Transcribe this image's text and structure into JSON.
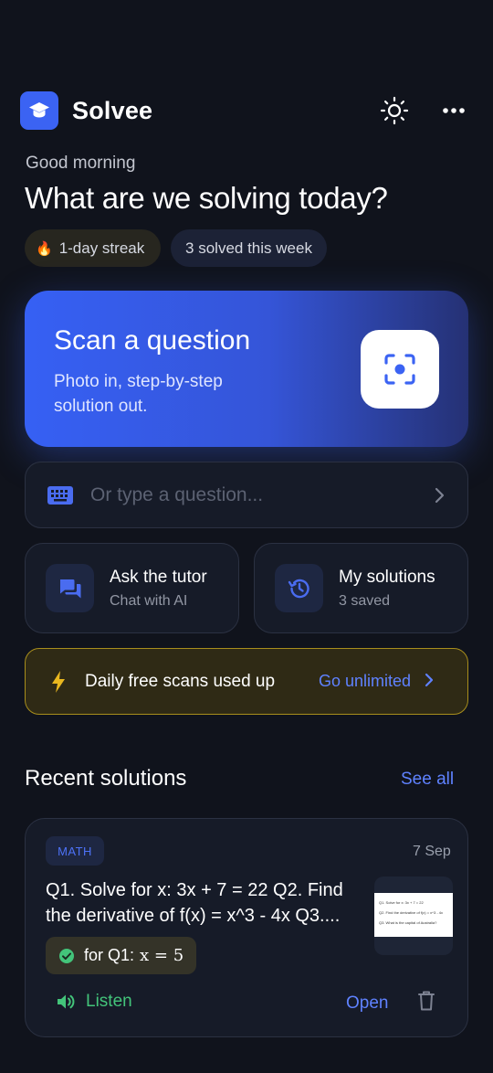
{
  "header": {
    "app_name": "Solvee",
    "logo_icon": "graduation-cap-icon",
    "theme_icon": "sun-icon",
    "menu_icon": "more-horizontal-icon"
  },
  "greeting": "Good morning",
  "headline": "What are we solving today?",
  "chips": {
    "streak_icon": "🔥",
    "streak": "1-day streak",
    "week": "3 solved this week"
  },
  "scan_card": {
    "title": "Scan a question",
    "subtitle": "Photo in, step-by-step solution out.",
    "icon": "scan-focus-icon"
  },
  "type_input": {
    "placeholder": "Or type a question...",
    "icon": "keyboard-icon",
    "chevron": "chevron-right-icon"
  },
  "tiles": [
    {
      "title": "Ask the tutor",
      "subtitle": "Chat with AI",
      "icon": "chat-bubbles-icon"
    },
    {
      "title": "My solutions",
      "subtitle": "3 saved",
      "icon": "history-icon"
    }
  ],
  "banner": {
    "text": "Daily free scans used up",
    "link": "Go unlimited",
    "icon": "lightning-icon",
    "color": "#a88e1c"
  },
  "recent": {
    "title": "Recent solutions",
    "see_all": "See all",
    "item": {
      "tag": "MATH",
      "date": "7 Sep",
      "question_line1": "Q1. Solve for x: 3x + 7 = 22 Q2. Find",
      "question_line2": "the derivative of f(x) = x^3 - 4x Q3....",
      "thumb_lines": [
        "Q1. Solve for x:  3x + 7 = 22",
        "Q2. Find the derivative of  f(x) = x^3 - 4x",
        "Q3. What is the capital of Australia?"
      ],
      "answer_prefix": "for Q1:",
      "answer_math": "x = 5",
      "listen": "Listen",
      "open": "Open"
    }
  },
  "colors": {
    "background": "#10131c",
    "accent": "#3b63f3",
    "link": "#5f82ff",
    "success": "#43c47a"
  }
}
